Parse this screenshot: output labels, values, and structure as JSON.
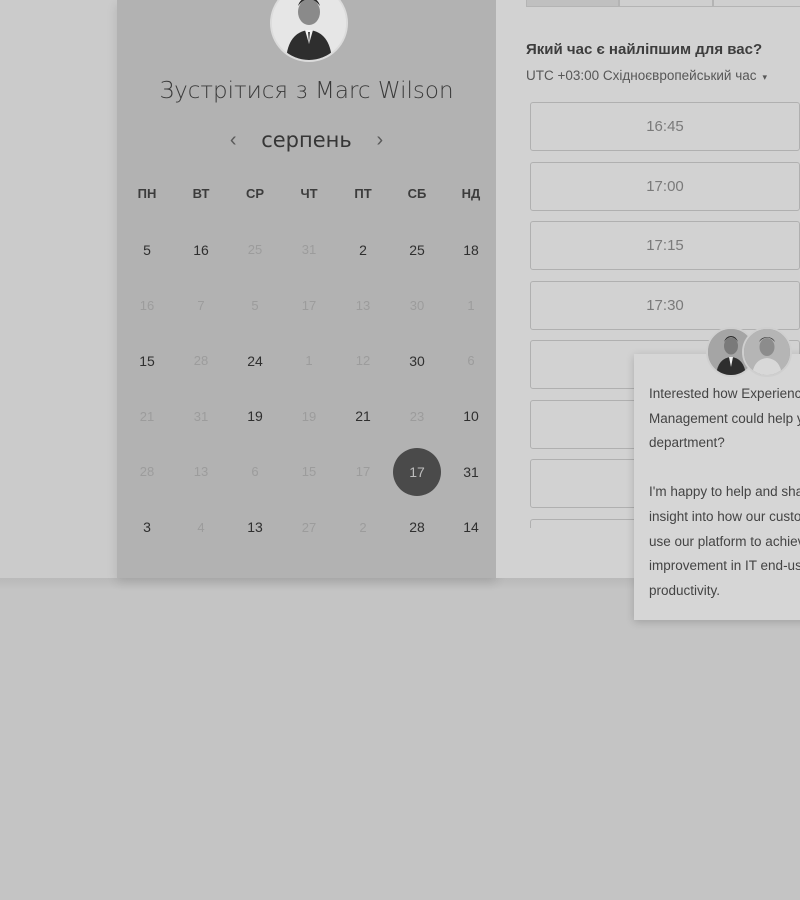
{
  "calendar": {
    "title": "Зустрітися з Marc Wilson",
    "month": "серпень",
    "prev_icon": "‹",
    "next_icon": "›",
    "weekdays": [
      "ПН",
      "ВТ",
      "СР",
      "ЧТ",
      "ПТ",
      "СБ",
      "НД"
    ],
    "weeks": [
      [
        "5",
        "16",
        "25",
        "31",
        "2",
        "25",
        "18"
      ],
      [
        "16",
        "7",
        "5",
        "17",
        "13",
        "30",
        "1"
      ],
      [
        "15",
        "28",
        "24",
        "1",
        "12",
        "30",
        "6"
      ],
      [
        "21",
        "31",
        "19",
        "19",
        "21",
        "23",
        "10"
      ],
      [
        "28",
        "13",
        "6",
        "15",
        "17",
        "17",
        "31"
      ],
      [
        "3",
        "4",
        "13",
        "27",
        "2",
        "28",
        "14"
      ]
    ],
    "muted": [
      [
        false,
        false,
        true,
        true,
        false,
        false,
        false
      ],
      [
        true,
        true,
        true,
        true,
        true,
        true,
        true
      ],
      [
        false,
        true,
        false,
        true,
        true,
        false,
        true
      ],
      [
        true,
        true,
        false,
        true,
        false,
        true,
        false
      ],
      [
        true,
        true,
        true,
        true,
        true,
        false,
        false
      ],
      [
        false,
        true,
        false,
        true,
        true,
        false,
        false
      ]
    ],
    "selected": {
      "week": 4,
      "day": 5
    }
  },
  "schedule": {
    "question": "Який час є найліпшим для вас?",
    "timezone": "UTC +03:00 Східноєвропейський час",
    "timezone_caret": "▾",
    "slots": [
      "16:45",
      "17:00",
      "17:15",
      "17:30",
      "",
      "",
      "",
      ""
    ]
  },
  "chat": {
    "lines": [
      "Interested how Experienc",
      "Management could help y",
      "department?",
      "",
      "I'm happy to help and sha",
      "insight into how our custo",
      "use our platform to achiev",
      "improvement in IT end-us",
      "productivity."
    ]
  }
}
